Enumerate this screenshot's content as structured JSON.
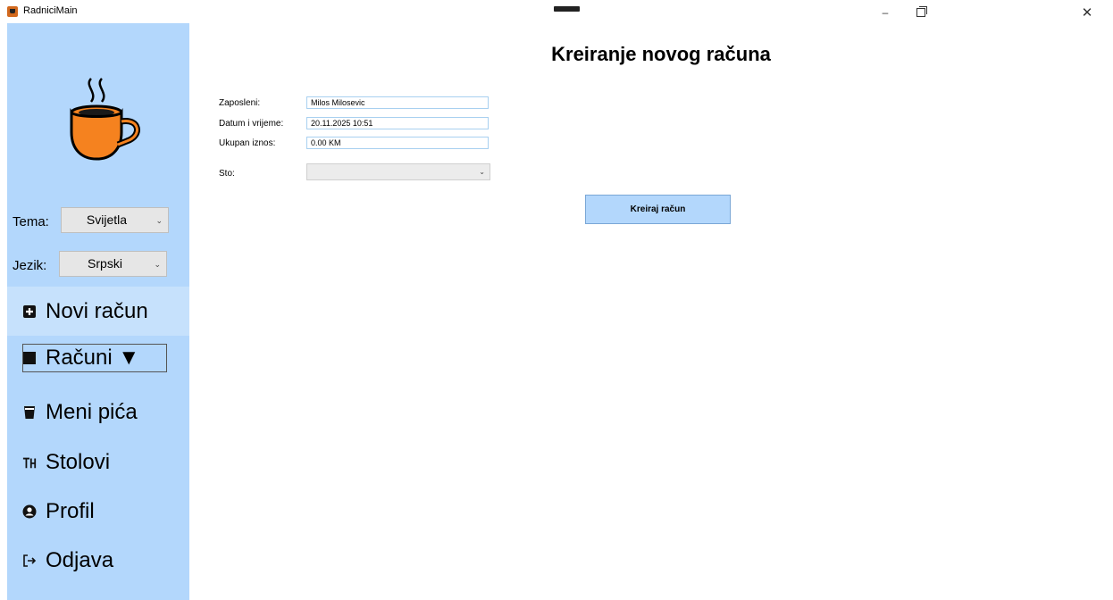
{
  "window": {
    "title": "RadniciMain",
    "minimize_glyph": "–",
    "close_glyph": "✕"
  },
  "sidebar": {
    "theme": {
      "label": "Tema:",
      "value": "Svijetla"
    },
    "language": {
      "label": "Jezik:",
      "value": "Srpski"
    },
    "nav": {
      "novi_racun": "Novi račun",
      "racuni": "Računi ▼",
      "meni_pica": "Meni pića",
      "stolovi": "Stolovi",
      "profil": "Profil",
      "odjava": "Odjava"
    }
  },
  "main": {
    "title": "Kreiranje novog računa",
    "fields": {
      "employee_label": "Zaposleni:",
      "employee_value": "Milos Milosevic",
      "datetime_label": "Datum i vrijeme:",
      "datetime_value": "20.11.2025 10:51",
      "total_label": "Ukupan iznos:",
      "total_value": "0.00 KM",
      "table_label": "Sto:",
      "table_value": ""
    },
    "create_button": "Kreiraj račun"
  },
  "colors": {
    "sidebar_bg": "#b3d7fc",
    "active_nav_bg": "#c6e1fc",
    "button_bg": "#b3d7fc",
    "cup_orange": "#f5821f"
  },
  "icons": {
    "app": "coffee-app-icon",
    "logo": "coffee-cup-icon",
    "novi_racun": "plus-square-icon",
    "racuni": "receipt-square-icon",
    "meni_pica": "glass-icon",
    "stolovi": "table-icon",
    "profil": "user-circle-icon",
    "odjava": "logout-icon"
  }
}
